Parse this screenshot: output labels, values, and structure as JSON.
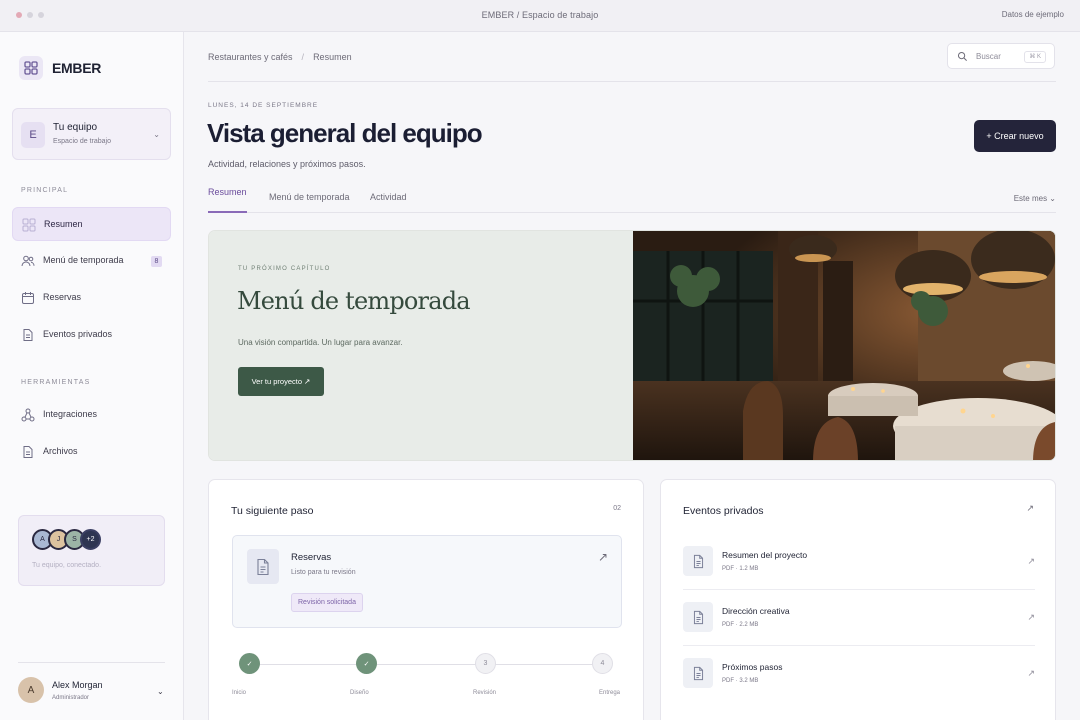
{
  "window": {
    "title": "EMBER / Espacio de trabajo",
    "right_label": "Datos de ejemplo"
  },
  "brand": {
    "name": "EMBER"
  },
  "team": {
    "initial": "E",
    "name": "Tu equipo",
    "subtitle": "Espacio de trabajo"
  },
  "sidebar": {
    "section_main": "PRINCIPAL",
    "section_tools": "HERRAMIENTAS",
    "items": [
      {
        "label": "Resumen",
        "icon": "grid-icon",
        "active": true
      },
      {
        "label": "Menú de temporada",
        "icon": "users-icon",
        "badge": "8"
      },
      {
        "label": "Reservas",
        "icon": "calendar-icon"
      },
      {
        "label": "Eventos privados",
        "icon": "document-icon"
      }
    ],
    "tools": [
      {
        "label": "Integraciones",
        "icon": "integrations-icon"
      },
      {
        "label": "Archivos",
        "icon": "document-icon"
      }
    ],
    "team_card": {
      "avatars": [
        "A",
        "J",
        "S",
        "+2"
      ],
      "text": "Tu equipo, conectado."
    },
    "user": {
      "initial": "A",
      "name": "Alex Morgan",
      "role": "Administrador"
    }
  },
  "header": {
    "breadcrumb": [
      "Restaurantes y cafés",
      "Resumen"
    ],
    "search_placeholder": "Buscar",
    "search_shortcut": "⌘ K",
    "date": "LUNES, 14 DE SEPTIEMBRE",
    "title": "Vista general del equipo",
    "subtitle": "Actividad, relaciones y próximos pasos.",
    "create_button": "+ Crear nuevo"
  },
  "tabs": {
    "items": [
      "Resumen",
      "Menú de temporada",
      "Actividad"
    ],
    "active": 0,
    "period": "Este mes ⌄"
  },
  "hero": {
    "eyebrow": "TU PRÓXIMO CAPÍTULO",
    "title": "Menú de temporada",
    "description": "Una visión compartida. Un lugar para avanzar.",
    "button": "Ver tu proyecto ↗"
  },
  "next_step": {
    "title": "Tu siguiente paso",
    "number": "02",
    "item_title": "Reservas",
    "item_subtitle": "Listo para tu revisión",
    "tag": "Revisión solicitada",
    "steps": [
      {
        "mark": "✓",
        "label": "Inicio",
        "done": true
      },
      {
        "mark": "✓",
        "label": "Diseño",
        "done": true
      },
      {
        "mark": "3",
        "label": "Revisión",
        "done": false
      },
      {
        "mark": "4",
        "label": "Entrega",
        "done": false
      }
    ]
  },
  "events": {
    "title": "Eventos privados",
    "files": [
      {
        "name": "Resumen del proyecto",
        "meta": "PDF · 1.2 MB"
      },
      {
        "name": "Dirección creativa",
        "meta": "PDF · 2.2 MB"
      },
      {
        "name": "Próximos pasos",
        "meta": "PDF · 3.2 MB"
      }
    ]
  }
}
